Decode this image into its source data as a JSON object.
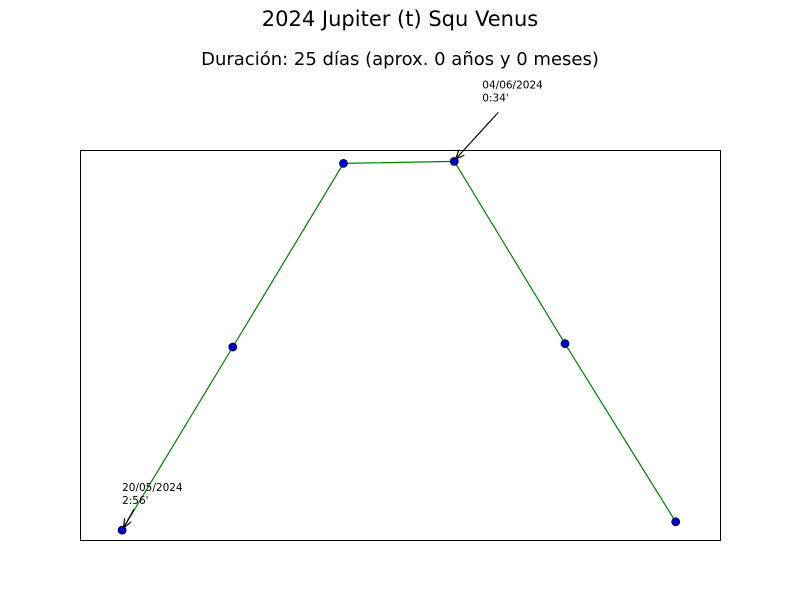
{
  "chart_data": {
    "type": "line",
    "title": "2024 Jupiter (t) Squ Venus",
    "subtitle": "Duración: 25 días (aprox. 0 años y 0 meses)",
    "xlabel": "",
    "ylabel": "",
    "axes_visible": false,
    "grid": false,
    "line_color": "#008000",
    "marker_color": "#0000cc",
    "x": [
      0,
      1,
      2,
      3,
      4,
      5
    ],
    "values": [
      2.93,
      57.4,
      112.0,
      112.6,
      58.4,
      5.4
    ],
    "xlim": [
      -0.38,
      5.4
    ],
    "ylim": [
      0,
      116
    ],
    "annotations": [
      {
        "index": 0,
        "date": "20/05/2024",
        "orb": "2:56'"
      },
      {
        "index": 3,
        "date": "04/06/2024",
        "orb": "0:34'"
      }
    ]
  }
}
